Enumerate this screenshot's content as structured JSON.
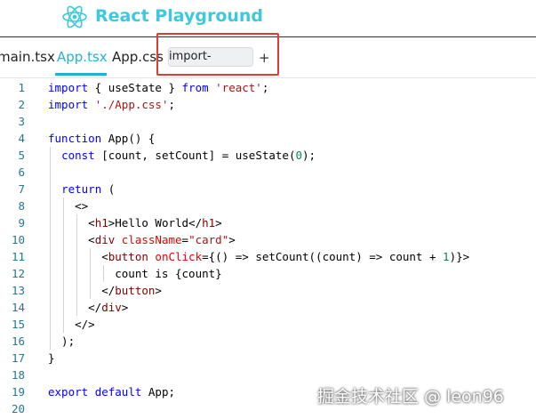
{
  "header": {
    "title": "React Playground",
    "logo_icon": "react-atom-icon",
    "brand_color": "#3bc9e0"
  },
  "tabs": [
    {
      "label": "main.tsx",
      "active": false
    },
    {
      "label": "App.tsx",
      "active": true
    },
    {
      "label": "App.css",
      "active": false
    }
  ],
  "new_tab_input": {
    "value": "import-map.json"
  },
  "add_tab_label": "+",
  "editor": {
    "line_numbers": [
      "1",
      "2",
      "3",
      "4",
      "5",
      "6",
      "7",
      "8",
      "9",
      "10",
      "11",
      "12",
      "13",
      "14",
      "15",
      "16",
      "17",
      "18",
      "19",
      "20"
    ],
    "lines": [
      [
        {
          "c": "k",
          "t": "import"
        },
        {
          "t": " { useState } "
        },
        {
          "c": "k",
          "t": "from"
        },
        {
          "t": " "
        },
        {
          "c": "s",
          "t": "'react'"
        },
        {
          "t": ";"
        }
      ],
      [
        {
          "c": "k",
          "t": "import"
        },
        {
          "t": " "
        },
        {
          "c": "s",
          "t": "'./App.css'"
        },
        {
          "t": ";"
        }
      ],
      [],
      [
        {
          "c": "k",
          "t": "function"
        },
        {
          "t": " App() {"
        }
      ],
      [
        {
          "t": "  "
        },
        {
          "c": "k",
          "t": "const"
        },
        {
          "t": " [count, setCount] = useState("
        },
        {
          "c": "n",
          "t": "0"
        },
        {
          "t": ");"
        }
      ],
      [],
      [
        {
          "t": "  "
        },
        {
          "c": "k",
          "t": "return"
        },
        {
          "t": " ("
        }
      ],
      [
        {
          "t": "    <>"
        }
      ],
      [
        {
          "t": "      <"
        },
        {
          "c": "t",
          "t": "h1"
        },
        {
          "t": ">Hello World</"
        },
        {
          "c": "t",
          "t": "h1"
        },
        {
          "t": ">"
        }
      ],
      [
        {
          "t": "      <"
        },
        {
          "c": "t",
          "t": "div"
        },
        {
          "t": " "
        },
        {
          "c": "a",
          "t": "className"
        },
        {
          "t": "="
        },
        {
          "c": "s",
          "t": "\"card\""
        },
        {
          "t": ">"
        }
      ],
      [
        {
          "t": "        <"
        },
        {
          "c": "t",
          "t": "button"
        },
        {
          "t": " "
        },
        {
          "c": "a",
          "t": "onClick"
        },
        {
          "t": "={() => setCount((count) => count + "
        },
        {
          "c": "n",
          "t": "1"
        },
        {
          "t": ")}>"
        }
      ],
      [
        {
          "t": "          count is {count}"
        }
      ],
      [
        {
          "t": "        </"
        },
        {
          "c": "t",
          "t": "button"
        },
        {
          "t": ">"
        }
      ],
      [
        {
          "t": "      </"
        },
        {
          "c": "t",
          "t": "div"
        },
        {
          "t": ">"
        }
      ],
      [
        {
          "t": "    </>"
        }
      ],
      [
        {
          "t": "  );"
        }
      ],
      [
        {
          "t": "}"
        }
      ],
      [],
      [
        {
          "c": "k",
          "t": "export"
        },
        {
          "t": " "
        },
        {
          "c": "k",
          "t": "default"
        },
        {
          "t": " App;"
        }
      ],
      []
    ]
  },
  "watermark": "掘金技术社区 @ leon96"
}
